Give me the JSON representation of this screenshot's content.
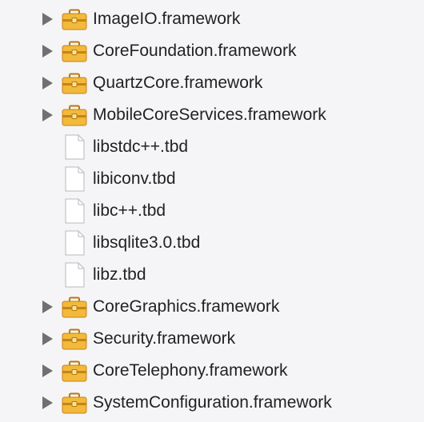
{
  "colors": {
    "background": "#f5f5f7",
    "text": "#222222",
    "disclosure": "#707070",
    "folder_body": "#f2b93b",
    "folder_dark": "#c78416",
    "file_fill": "#ffffff",
    "file_stroke": "#b9b9b9"
  },
  "file_list": {
    "items": [
      {
        "label": "ImageIO.framework",
        "kind": "framework",
        "icon": "toolbox-icon"
      },
      {
        "label": "CoreFoundation.framework",
        "kind": "framework",
        "icon": "toolbox-icon"
      },
      {
        "label": "QuartzCore.framework",
        "kind": "framework",
        "icon": "toolbox-icon"
      },
      {
        "label": "MobileCoreServices.framework",
        "kind": "framework",
        "icon": "toolbox-icon"
      },
      {
        "label": "libstdc++.tbd",
        "kind": "file",
        "icon": "file-icon"
      },
      {
        "label": "libiconv.tbd",
        "kind": "file",
        "icon": "file-icon"
      },
      {
        "label": "libc++.tbd",
        "kind": "file",
        "icon": "file-icon"
      },
      {
        "label": "libsqlite3.0.tbd",
        "kind": "file",
        "icon": "file-icon"
      },
      {
        "label": "libz.tbd",
        "kind": "file",
        "icon": "file-icon"
      },
      {
        "label": "CoreGraphics.framework",
        "kind": "framework",
        "icon": "toolbox-icon"
      },
      {
        "label": "Security.framework",
        "kind": "framework",
        "icon": "toolbox-icon"
      },
      {
        "label": "CoreTelephony.framework",
        "kind": "framework",
        "icon": "toolbox-icon"
      },
      {
        "label": "SystemConfiguration.framework",
        "kind": "framework",
        "icon": "toolbox-icon"
      }
    ]
  }
}
